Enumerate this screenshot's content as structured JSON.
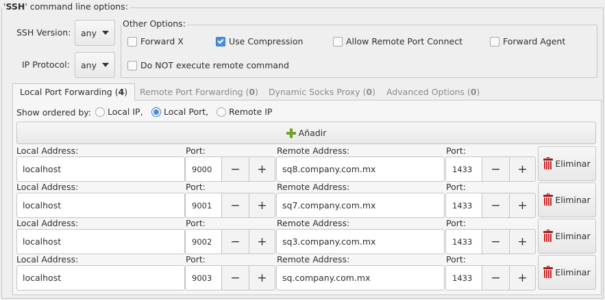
{
  "ssh_frame": {
    "legend_pre": "'",
    "legend_bold": "SSH",
    "legend_post": "' command line options:"
  },
  "ssh_version": {
    "label": "SSH Version:",
    "value": "any"
  },
  "ip_protocol": {
    "label": "IP Protocol:",
    "value": "any"
  },
  "other_options": {
    "legend": "Other Options:",
    "forward_x": {
      "label": "Forward X",
      "checked": false
    },
    "use_compression": {
      "label": "Use Compression",
      "checked": true
    },
    "allow_remote": {
      "label": "Allow Remote Port Connect",
      "checked": false
    },
    "forward_agent": {
      "label": "Forward Agent",
      "checked": false
    },
    "no_remote_cmd": {
      "label": "Do NOT execute remote command",
      "checked": false
    }
  },
  "tabs": [
    {
      "label": "Local Port Forwarding (",
      "count": "4",
      "close": ")",
      "active": true
    },
    {
      "label": "Remote Port Forwarding (",
      "count": "0",
      "close": ")",
      "active": false
    },
    {
      "label": "Dynamic Socks Proxy (",
      "count": "0",
      "close": ")",
      "active": false
    },
    {
      "label": "Advanced Options (",
      "count": "0",
      "close": ")",
      "active": false
    }
  ],
  "order": {
    "label": "Show ordered by:",
    "local_ip": "Local IP,",
    "local_port": "Local Port,",
    "remote_ip": "Remote IP",
    "selected": "local_port"
  },
  "add_button": {
    "label": "Añadir"
  },
  "row_labels": {
    "local_address": "Local Address:",
    "port": "Port:",
    "remote_address": "Remote Address:",
    "minus": "−",
    "plus": "+",
    "delete": "Eliminar"
  },
  "forwards": [
    {
      "local_address": "localhost",
      "local_port": "9000",
      "remote_address": "sq8.company.com.mx",
      "remote_port": "1433"
    },
    {
      "local_address": "localhost",
      "local_port": "9001",
      "remote_address": "sq7.company.com.mx",
      "remote_port": "1433"
    },
    {
      "local_address": "localhost",
      "local_port": "9002",
      "remote_address": "sq3.company.com.mx",
      "remote_port": "1433"
    },
    {
      "local_address": "localhost",
      "local_port": "9003",
      "remote_address": "sq.company.com.mx",
      "remote_port": "1433"
    }
  ],
  "colors": {
    "accent": "#4a90d9",
    "delete_icon": "#c4201f",
    "add_icon": "#6fa325"
  }
}
